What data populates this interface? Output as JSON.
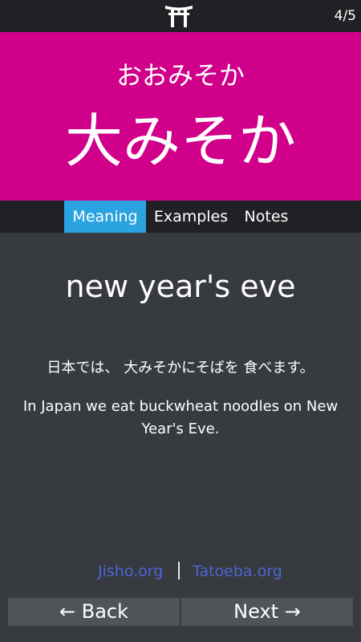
{
  "header": {
    "logo_icon": "torii-gate-icon",
    "progress": "4/5"
  },
  "card": {
    "reading": "おおみそか",
    "word": "大みそか",
    "background_color": "#d1008b"
  },
  "tabs": [
    {
      "label": "Meaning",
      "active": true
    },
    {
      "label": "Examples",
      "active": false
    },
    {
      "label": "Notes",
      "active": false
    }
  ],
  "content": {
    "meaning": "new year's eve",
    "example_japanese": "日本では、 大みそかにそばを 食べます。",
    "example_english": "In Japan we eat buckwheat noodles on New Year's Eve."
  },
  "links": {
    "jisho": "Jisho.org",
    "tatoeba": "Tatoeba.org",
    "color": "#4a67d6"
  },
  "navigation": {
    "back_label": "← Back",
    "next_label": "Next →"
  }
}
